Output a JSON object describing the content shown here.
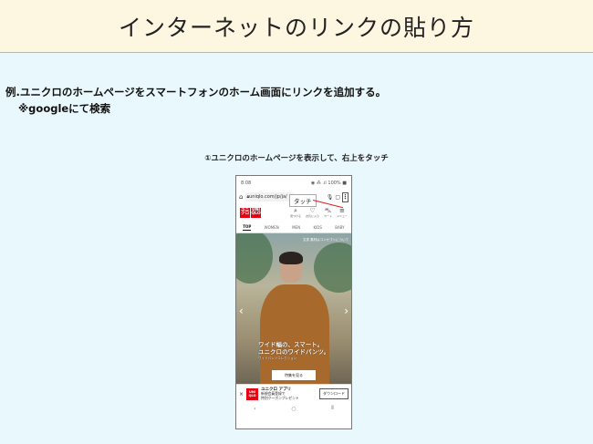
{
  "header": {
    "title": "インターネットのリンクの貼り方"
  },
  "intro": {
    "line1": "例.ユニクロのホームページをスマートフォンのホーム画面にリンクを追加する。",
    "line2": "※googleにて検索"
  },
  "step": {
    "caption": "①ユニクロのホームページを表示して、右上をタッチ"
  },
  "phone": {
    "status_time": "8:08",
    "status_right": "◉ ⁂ .ıl 100% ■",
    "url": "uniqlo.com/jp/ja/",
    "tap_label": "タッチ",
    "menu_glyph": "⋮",
    "logo": {
      "top": "ユニ\nクロ",
      "bottom": "UNI\nQLO"
    },
    "header_icons": [
      {
        "glyph": "⌕",
        "label": "見つける"
      },
      {
        "glyph": "♡",
        "label": "お気に入り"
      },
      {
        "glyph": "⛍",
        "label": "カート"
      },
      {
        "glyph": "≡",
        "label": "メニュー"
      }
    ],
    "tabs": [
      "TOP",
      "WOMEN",
      "MEN",
      "KIDS",
      "BABY"
    ],
    "hero": {
      "caption": "文書 素材はコンセプトについて",
      "headline_1": "ワイド幅の、スマート。",
      "headline_2": "ユニクロのワイドパンツ。",
      "sub": "ワイドパンツコレクション",
      "cta": "特集を見る"
    },
    "app_banner": {
      "close": "×",
      "logo": "UNI\nQLO",
      "name": "ユニクロ アプリ",
      "line2": "新規会員登録で",
      "line3": "特別クーポンプレゼント",
      "download": "ダウンロード"
    },
    "nav": [
      "‹",
      "○",
      "⦀"
    ]
  }
}
